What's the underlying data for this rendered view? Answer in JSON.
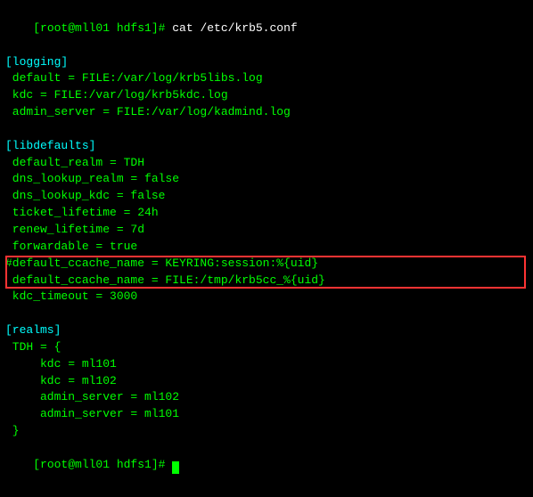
{
  "terminal": {
    "prompt1": "[root@mll01 hdfs1]# ",
    "cmd1": "cat /etc/krb5.conf",
    "lines": [
      {
        "type": "section",
        "text": "[logging]"
      },
      {
        "type": "normal",
        "text": " default = FILE:/var/log/krb5libs.log"
      },
      {
        "type": "normal",
        "text": " kdc = FILE:/var/log/krb5kdc.log"
      },
      {
        "type": "normal",
        "text": " admin_server = FILE:/var/log/kadmind.log"
      },
      {
        "type": "blank",
        "text": ""
      },
      {
        "type": "section",
        "text": "[libdefaults]"
      },
      {
        "type": "normal",
        "text": " default_realm = TDH"
      },
      {
        "type": "normal",
        "text": " dns_lookup_realm = false"
      },
      {
        "type": "normal",
        "text": " dns_lookup_kdc = false"
      },
      {
        "type": "normal",
        "text": " ticket_lifetime = 24h"
      },
      {
        "type": "normal",
        "text": " renew_lifetime = 7d"
      },
      {
        "type": "normal",
        "text": " forwardable = true"
      },
      {
        "type": "highlighted1",
        "text": "#default_ccache_name = KEYRING:session:%{uid}"
      },
      {
        "type": "highlighted2",
        "text": " default_ccache_name = FILE:/tmp/krb5cc_%{uid}"
      },
      {
        "type": "normal",
        "text": " kdc_timeout = 3000"
      },
      {
        "type": "blank",
        "text": ""
      },
      {
        "type": "section",
        "text": "[realms]"
      },
      {
        "type": "normal",
        "text": " TDH = {"
      },
      {
        "type": "normal",
        "text": "     kdc = ml101"
      },
      {
        "type": "normal",
        "text": "     kdc = ml102"
      },
      {
        "type": "normal",
        "text": "     admin_server = ml102"
      },
      {
        "type": "normal",
        "text": "     admin_server = ml101"
      },
      {
        "type": "normal",
        "text": " }"
      },
      {
        "type": "prompt_final",
        "text": "[root@mll01 hdfs1]# "
      }
    ]
  }
}
